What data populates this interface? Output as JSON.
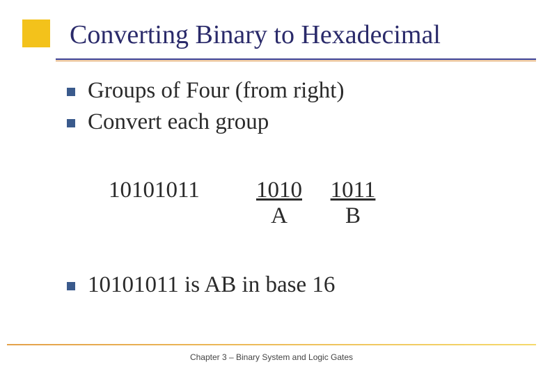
{
  "title": "Converting Binary to Hexadecimal",
  "bullets": {
    "b1": "Groups of Four (from right)",
    "b2": "Convert each group",
    "b3": "10101011 is AB in base 16"
  },
  "example": {
    "original": "10101011",
    "groups": [
      "1010",
      "1011"
    ],
    "hex": [
      "A",
      "B"
    ]
  },
  "footer": {
    "chapter": "Chapter 3 – Binary  System and Logic Gates"
  }
}
